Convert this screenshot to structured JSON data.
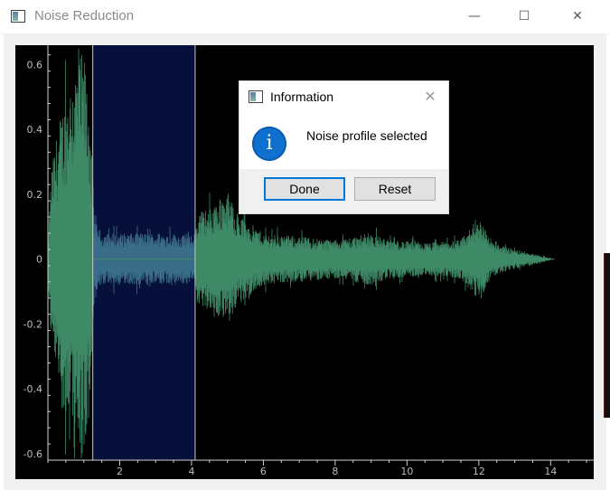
{
  "window": {
    "title": "Noise Reduction",
    "minimize_glyph": "—",
    "maximize_glyph": "☐",
    "close_glyph": "✕"
  },
  "chart_data": {
    "type": "line",
    "title": "",
    "xlabel": "",
    "ylabel": "",
    "xlim": [
      0,
      15.2
    ],
    "ylim": [
      -0.62,
      0.66
    ],
    "x_ticks": [
      2,
      4,
      6,
      8,
      10,
      12,
      14
    ],
    "x_tick_labels": [
      "2",
      "4",
      "6",
      "8",
      "10",
      "12",
      "14"
    ],
    "y_ticks": [
      0.6,
      0.4,
      0.2,
      0,
      -0.2,
      -0.4,
      -0.6
    ],
    "y_tick_labels": [
      "0.6",
      "0.4",
      "0.2",
      "0",
      "-0.2",
      "-0.4",
      "-0.6"
    ],
    "grid": false,
    "waveform_color": "#3e8a66",
    "selection_color": "#07103a",
    "selected_waveform_color": "#3a6e88",
    "selection_line_color": "#c8c8c8",
    "selection": {
      "x_start": 1.25,
      "x_end": 4.1
    },
    "envelope": [
      {
        "x": 0.0,
        "amp": 0.05
      },
      {
        "x": 0.1,
        "amp": 0.28
      },
      {
        "x": 0.3,
        "amp": 0.42
      },
      {
        "x": 0.6,
        "amp": 0.55
      },
      {
        "x": 0.85,
        "amp": 0.62
      },
      {
        "x": 1.0,
        "amp": 0.64
      },
      {
        "x": 1.15,
        "amp": 0.5
      },
      {
        "x": 1.3,
        "amp": 0.12
      },
      {
        "x": 1.5,
        "amp": 0.08
      },
      {
        "x": 2.5,
        "amp": 0.08
      },
      {
        "x": 3.5,
        "amp": 0.08
      },
      {
        "x": 4.05,
        "amp": 0.07
      },
      {
        "x": 4.2,
        "amp": 0.15
      },
      {
        "x": 4.6,
        "amp": 0.16
      },
      {
        "x": 5.0,
        "amp": 0.21
      },
      {
        "x": 5.3,
        "amp": 0.14
      },
      {
        "x": 6.0,
        "amp": 0.08
      },
      {
        "x": 7.0,
        "amp": 0.07
      },
      {
        "x": 8.0,
        "amp": 0.06
      },
      {
        "x": 9.0,
        "amp": 0.08
      },
      {
        "x": 9.5,
        "amp": 0.06
      },
      {
        "x": 10.5,
        "amp": 0.05
      },
      {
        "x": 11.5,
        "amp": 0.06
      },
      {
        "x": 12.0,
        "amp": 0.13
      },
      {
        "x": 12.4,
        "amp": 0.05
      },
      {
        "x": 13.0,
        "amp": 0.03
      },
      {
        "x": 13.6,
        "amp": 0.015
      },
      {
        "x": 14.1,
        "amp": 0.0
      }
    ]
  },
  "dialog": {
    "title": "Information",
    "close_glyph": "✕",
    "icon_glyph": "i",
    "message": "Noise profile selected",
    "done_label": "Done",
    "reset_label": "Reset"
  }
}
